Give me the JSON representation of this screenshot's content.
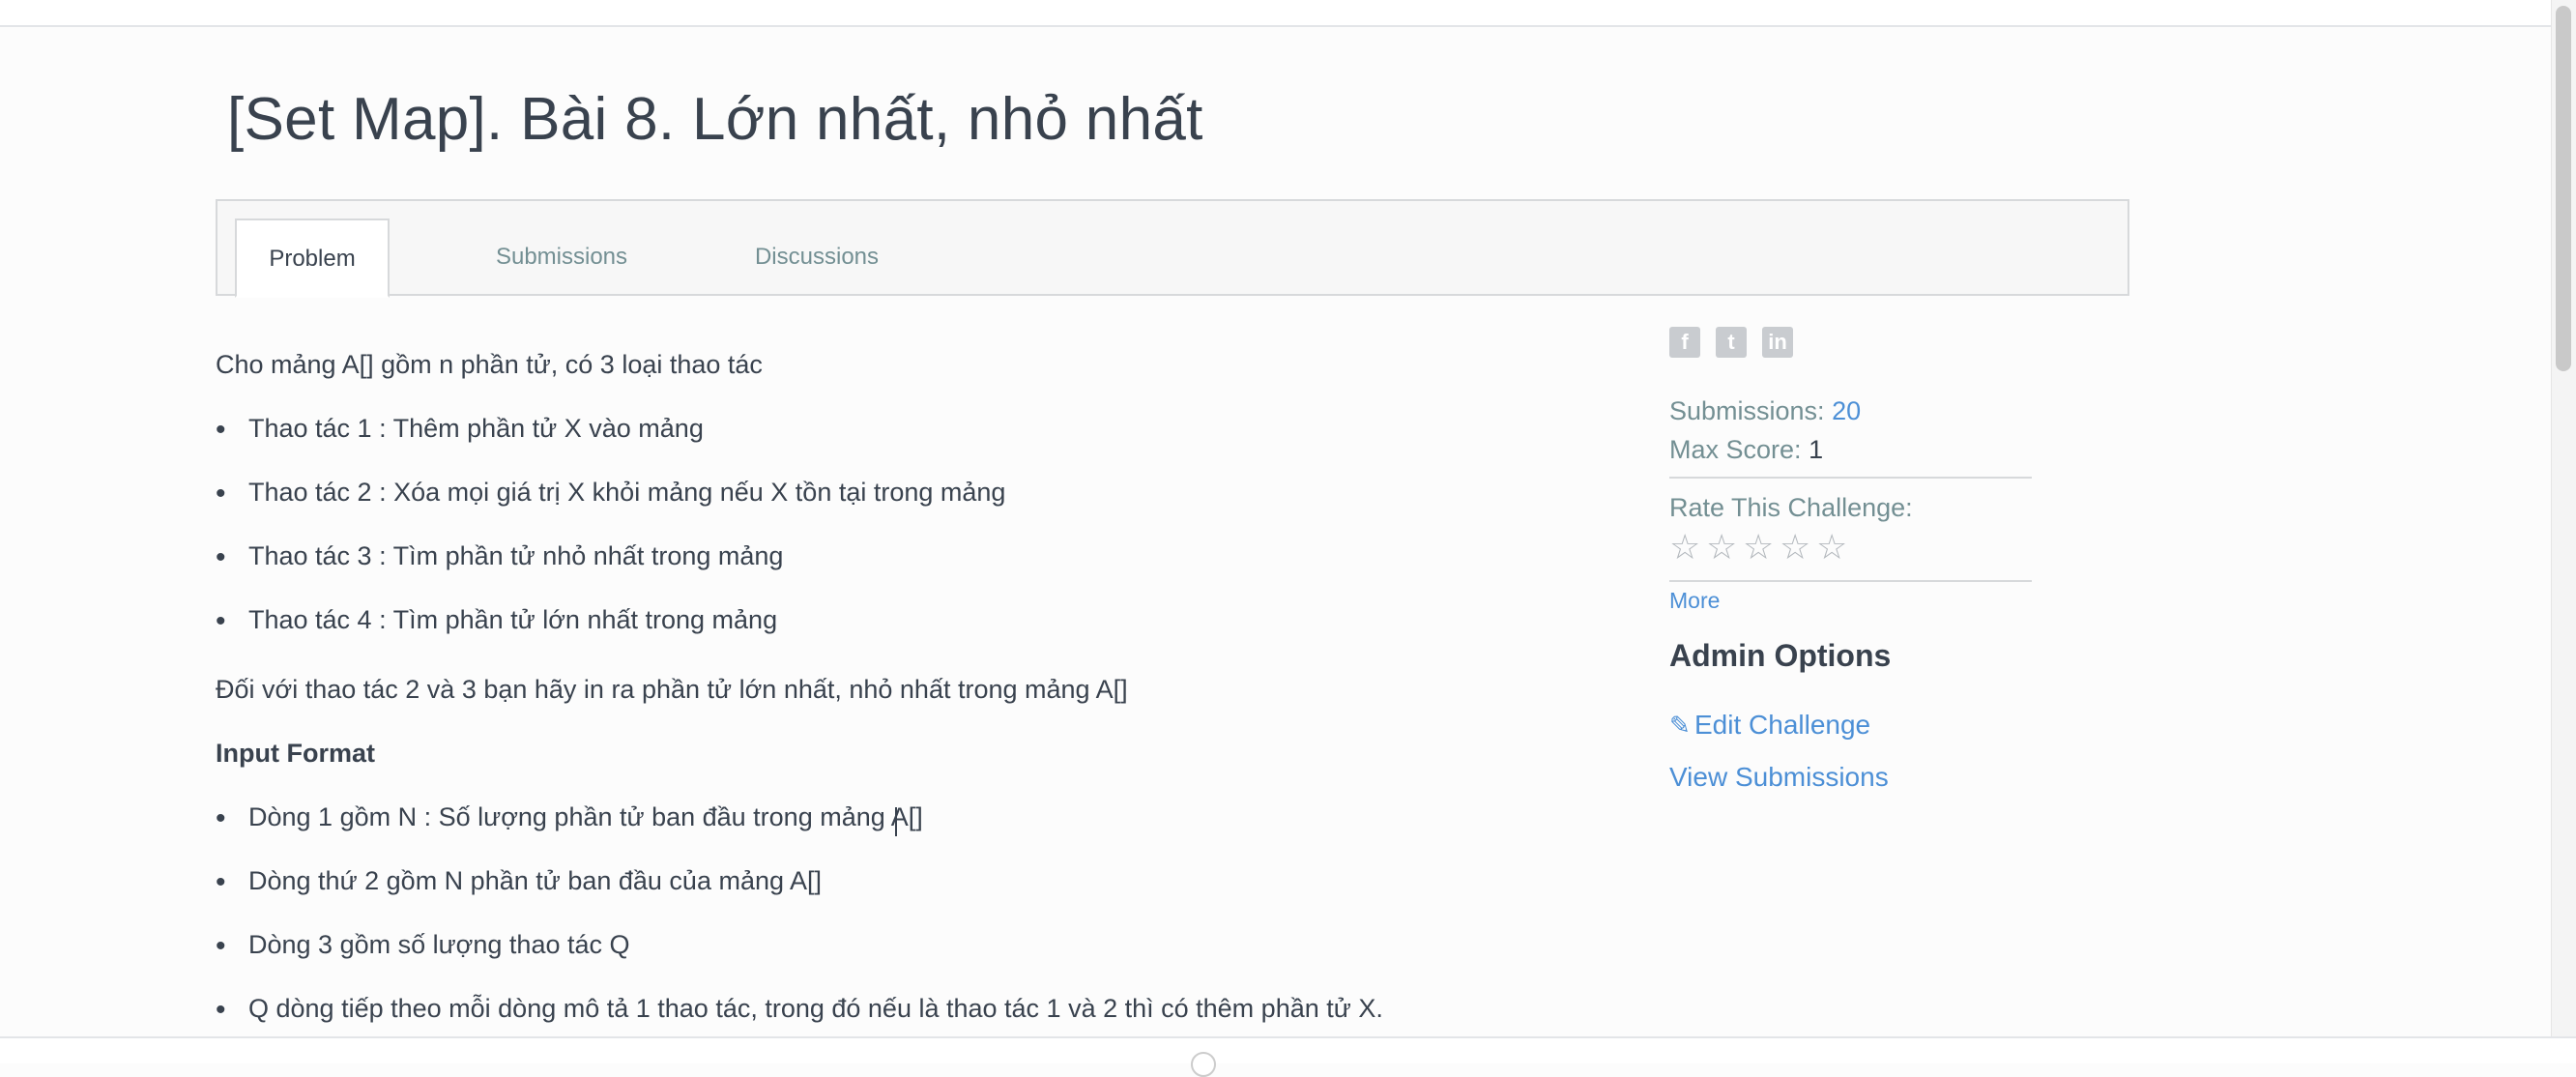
{
  "page": {
    "title": "[Set Map]. Bài 8. Lớn nhất, nhỏ nhất"
  },
  "tabs": [
    {
      "label": "Problem",
      "active": true
    },
    {
      "label": "Submissions",
      "active": false
    },
    {
      "label": "Discussions",
      "active": false
    }
  ],
  "problem": {
    "intro": "Cho mảng A[] gồm n phần tử, có 3 loại thao tác",
    "operations": [
      "Thao tác 1 : Thêm phần tử X vào mảng",
      "Thao tác 2 : Xóa mọi giá trị X khỏi mảng nếu X tồn tại trong mảng",
      "Thao tác 3 : Tìm phần tử nhỏ nhất trong mảng",
      "Thao tác 4 : Tìm phần tử lớn nhất trong mảng"
    ],
    "task": "Đối với thao tác 2 và 3 bạn hãy in ra phần tử lớn nhất, nhỏ nhất trong mảng A[]",
    "input_heading": "Input Format",
    "input_items": [
      "Dòng 1 gồm N : Số lượng phần tử ban đầu trong mảng A[]",
      "Dòng thứ 2 gồm N phần tử ban đầu của mảng A[]",
      "Dòng 3 gồm số lượng thao tác Q",
      "Q dòng tiếp theo mỗi dòng mô tả 1 thao tác, trong đó nếu là thao tác 1 và 2 thì có thêm phần tử X."
    ]
  },
  "sidebar": {
    "social_icons": [
      "facebook-icon",
      "twitter-icon",
      "linkedin-icon"
    ],
    "submissions_label": "Submissions:",
    "submissions_value": "20",
    "max_score_label": "Max Score:",
    "max_score_value": "1",
    "rate_label": "Rate This Challenge:",
    "rating": 0,
    "rating_max": 5,
    "more_label": "More",
    "admin_title": "Admin Options",
    "edit_label": "Edit Challenge",
    "view_label": "View Submissions"
  },
  "colors": {
    "text": "#39424e",
    "muted": "#738f93",
    "link": "#4c8fd6",
    "border": "#d7d9db"
  }
}
